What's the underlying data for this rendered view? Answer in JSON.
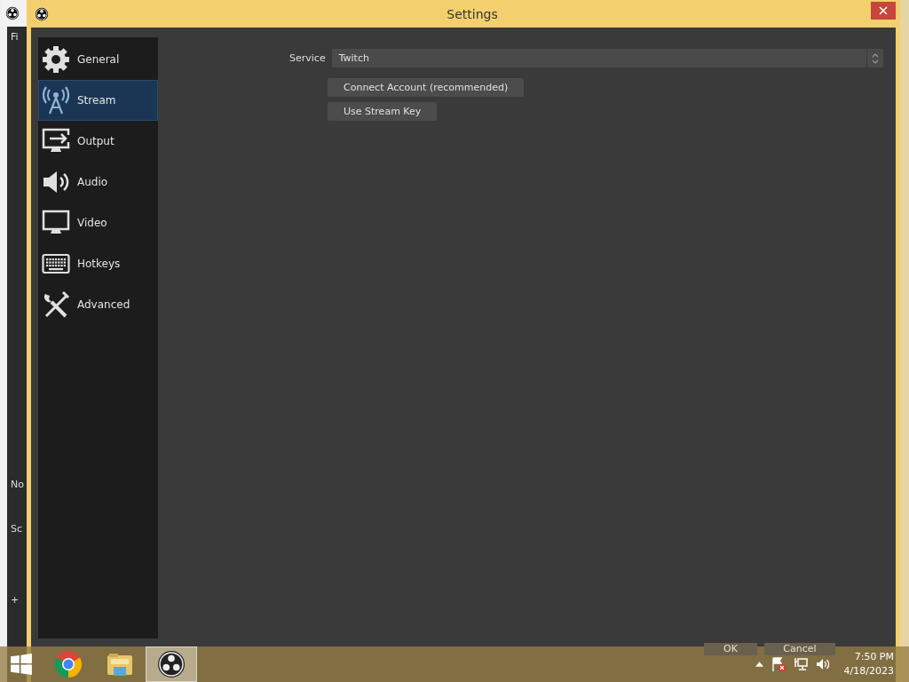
{
  "background_window": {
    "labels": [
      "Fi",
      "No",
      "Sc",
      "+"
    ]
  },
  "window": {
    "title": "Settings"
  },
  "sidebar": {
    "items": [
      {
        "label": "General",
        "kind": "gear",
        "selected": false
      },
      {
        "label": "Stream",
        "kind": "antenna",
        "selected": true
      },
      {
        "label": "Output",
        "kind": "output",
        "selected": false
      },
      {
        "label": "Audio",
        "kind": "speaker",
        "selected": false
      },
      {
        "label": "Video",
        "kind": "monitor",
        "selected": false
      },
      {
        "label": "Hotkeys",
        "kind": "keyboard",
        "selected": false
      },
      {
        "label": "Advanced",
        "kind": "tools",
        "selected": false
      }
    ]
  },
  "stream": {
    "service_label": "Service",
    "service_value": "Twitch",
    "buttons": [
      "Connect Account (recommended)",
      "Use Stream Key"
    ]
  },
  "dialog_buttons": [
    "OK",
    "Cancel"
  ],
  "taskbar": {
    "apps": [
      {
        "kind": "chrome",
        "selected": false
      },
      {
        "kind": "explorer",
        "selected": false
      },
      {
        "kind": "obs",
        "selected": true
      }
    ],
    "time": "7:50 PM",
    "date": "4/18/2023"
  }
}
